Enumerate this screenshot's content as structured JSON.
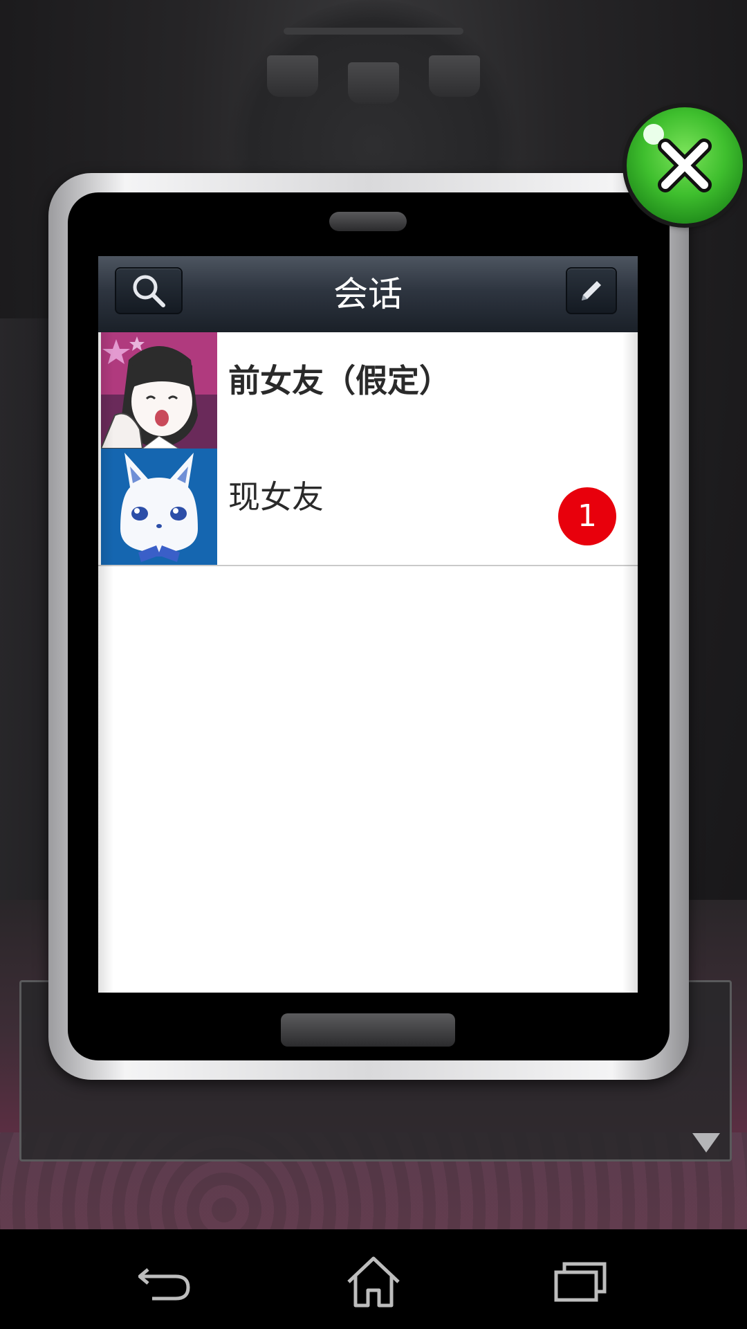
{
  "conversation_screen": {
    "title": "会话",
    "search_icon": "search-icon",
    "edit_icon": "pencil-icon",
    "conversations": [
      {
        "name": "前女友（假定）",
        "unread": ""
      },
      {
        "name": "现女友",
        "unread": "1"
      }
    ]
  },
  "close_button": {
    "icon": "close-x-icon"
  },
  "colors": {
    "badge": "#e8000c",
    "header_top": "#4d5560",
    "header_bottom": "#1a2028",
    "close_green": "#3fbf2e"
  },
  "navbar": {
    "back_icon": "back-icon",
    "home_icon": "home-icon",
    "recent_icon": "recent-apps-icon"
  }
}
